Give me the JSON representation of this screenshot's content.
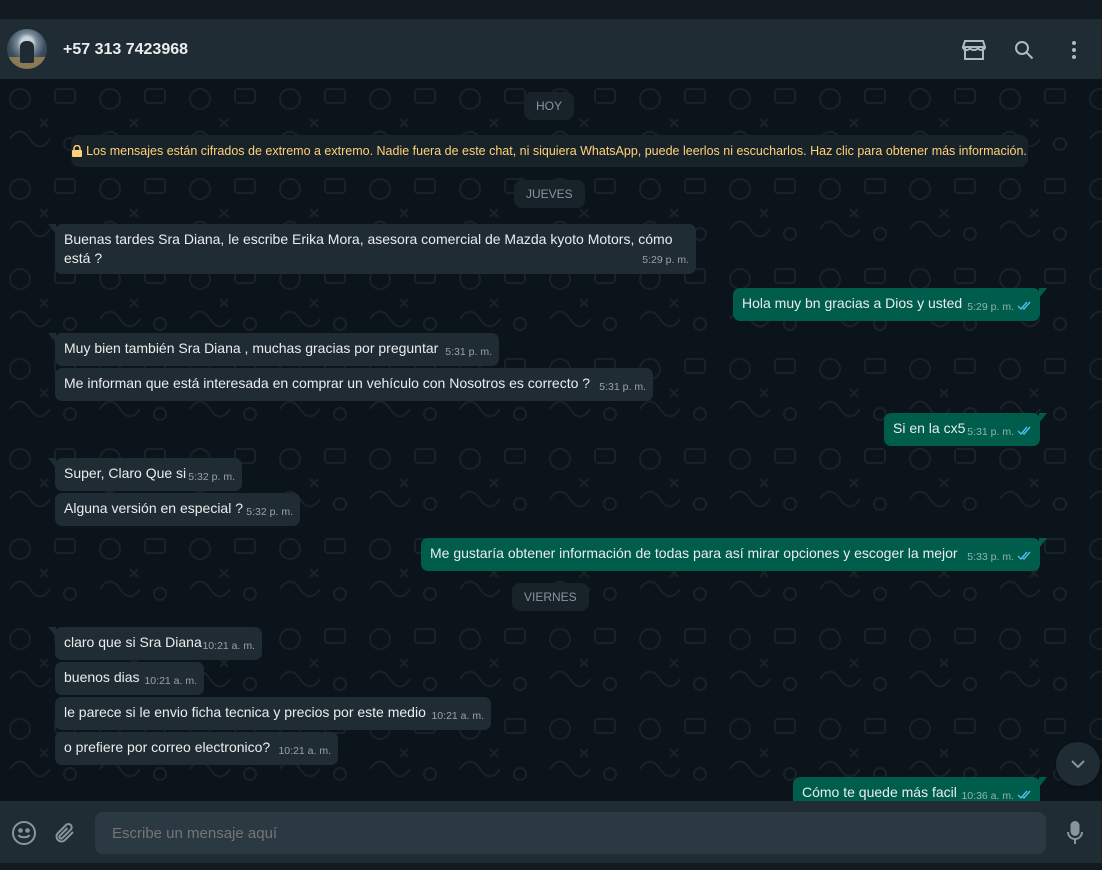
{
  "header": {
    "contact": "+57 313 7423968",
    "icons": [
      "store-icon",
      "search-icon",
      "menu-icon"
    ]
  },
  "chat": {
    "date_today": "HOY",
    "encryption_notice": "Los mensajes están cifrados de extremo a extremo. Nadie fuera de este chat, ni siquiera WhatsApp, puede leerlos ni escucharlos. Haz clic para obtener más información.",
    "date_thursday": "JUEVES",
    "date_friday": "VIERNES",
    "messages": [
      {
        "dir": "in",
        "text": "Buenas tardes Sra Diana, le escribe Erika Mora, asesora comercial de Mazda kyoto Motors, cómo está ?",
        "time": "5:29 p. m."
      },
      {
        "dir": "out",
        "text": "Hola muy bn gracias a Dios y usted",
        "time": "5:29 p. m.",
        "read": true
      },
      {
        "dir": "in",
        "text": "Muy bien también Sra Diana , muchas gracias por preguntar",
        "time": "5:31 p. m."
      },
      {
        "dir": "in",
        "text": "Me informan que está interesada en comprar un vehículo con Nosotros es correcto ?",
        "time": "5:31 p. m."
      },
      {
        "dir": "out",
        "text": "Si en la cx5",
        "time": "5:31 p. m.",
        "read": true
      },
      {
        "dir": "in",
        "text": "Super, Claro Que si",
        "time": "5:32 p. m."
      },
      {
        "dir": "in",
        "text": "Alguna versión en especial ?",
        "time": "5:32 p. m."
      },
      {
        "dir": "out",
        "text": "Me gustaría obtener información de todas para así mirar opciones y escoger la mejor",
        "time": "5:33 p. m.",
        "read": true
      },
      {
        "dir": "in",
        "text": "claro que si Sra Diana",
        "time": "10:21 a. m."
      },
      {
        "dir": "in",
        "text": "buenos dias",
        "time": "10:21 a. m."
      },
      {
        "dir": "in",
        "text": "le parece si le envio ficha tecnica y precios por este medio",
        "time": "10:21 a. m."
      },
      {
        "dir": "in",
        "text": "o prefiere por correo electronico?",
        "time": "10:21 a. m."
      },
      {
        "dir": "out",
        "text": "Cómo te quede más facil",
        "time": "10:36 a. m.",
        "read": true
      }
    ]
  },
  "composer": {
    "placeholder": "Escribe un mensaje aquí"
  },
  "colors": {
    "incoming": "#202c33",
    "outgoing": "#005c4b",
    "background": "#0b141a",
    "read_ticks": "#53bdeb"
  }
}
